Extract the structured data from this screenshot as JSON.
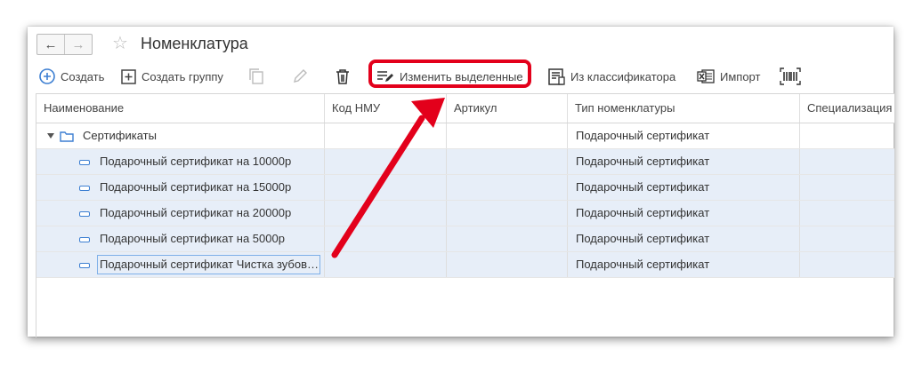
{
  "window": {
    "title": "Номенклатура"
  },
  "nav": {
    "back": "←",
    "forward": "→",
    "favorite": "☆"
  },
  "toolbar": {
    "create": "Создать",
    "create_group": "Создать группу",
    "edit_selected": "Изменить выделенные",
    "from_classifier": "Из классификатора",
    "import": "Импорт"
  },
  "columns": [
    "Наименование",
    "Код НМУ",
    "Артикул",
    "Тип номенклатуры",
    "Специализация"
  ],
  "group": {
    "name": "Сертификаты",
    "type": "Подарочный сертификат"
  },
  "rows": [
    {
      "name": "Подарочный сертификат на 10000р",
      "code": "",
      "article": "",
      "type": "Подарочный сертификат",
      "spec": ""
    },
    {
      "name": "Подарочный сертификат на 15000р",
      "code": "",
      "article": "",
      "type": "Подарочный сертификат",
      "spec": ""
    },
    {
      "name": "Подарочный сертификат на 20000р",
      "code": "",
      "article": "",
      "type": "Подарочный сертификат",
      "spec": ""
    },
    {
      "name": "Подарочный сертификат на 5000р",
      "code": "",
      "article": "",
      "type": "Подарочный сертификат",
      "spec": ""
    },
    {
      "name": "Подарочный сертификат Чистка зубов…",
      "code": "",
      "article": "",
      "type": "Подарочный сертификат",
      "spec": ""
    }
  ],
  "icons": [
    "back-arrow-icon",
    "forward-arrow-icon",
    "star-icon",
    "plus-circle-icon",
    "plus-square-icon",
    "copy-icon",
    "pencil-icon",
    "trash-icon",
    "edit-lines-icon",
    "classifier-icon",
    "excel-icon",
    "barcode-icon",
    "folder-icon",
    "item-icon"
  ],
  "colors": {
    "accent": "#3d7fd2",
    "highlight": "#e3001b",
    "selected_row": "#e7eef8"
  }
}
